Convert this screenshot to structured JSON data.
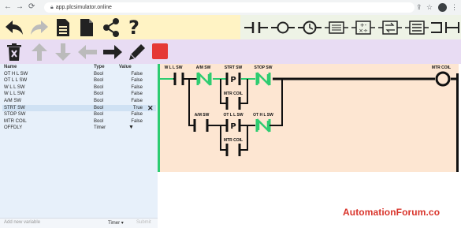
{
  "browser": {
    "url": "app.plcsimulator.online"
  },
  "toolbar_top": {
    "left_buttons": [
      "undo-icon",
      "redo-icon",
      "document-icon",
      "new-file-icon",
      "share-icon",
      "help-icon"
    ],
    "right_buttons": [
      "contact-no-icon",
      "coil-icon",
      "timer-icon",
      "compare-icon",
      "math-icon",
      "move-icon",
      "counter-icon",
      "branch-icon",
      "wire-icon"
    ]
  },
  "toolbar_second": {
    "buttons": [
      "delete-icon",
      "arrow-up-icon",
      "arrow-down-icon",
      "arrow-left-icon",
      "arrow-right-icon",
      "pencil-icon",
      "stop-icon"
    ],
    "accent_stop": "#e53935"
  },
  "variables": {
    "headers": {
      "name": "Name",
      "type": "Type",
      "value": "Value"
    },
    "rows": [
      {
        "name": "OT H L SW",
        "type": "Bool",
        "value": "False"
      },
      {
        "name": "OT L L SW",
        "type": "Bool",
        "value": "False"
      },
      {
        "name": "W L L SW",
        "type": "Bool",
        "value": "False"
      },
      {
        "name": "W L L SW",
        "type": "Bool",
        "value": "False"
      },
      {
        "name": "A/M SW",
        "type": "Bool",
        "value": "False"
      },
      {
        "name": "STRT SW",
        "type": "Bool",
        "value": "True"
      },
      {
        "name": "STOP SW",
        "type": "Bool",
        "value": "False"
      },
      {
        "name": "MTR COIL",
        "type": "Bool",
        "value": "False"
      },
      {
        "name": "OFFDLY",
        "type": "Timer",
        "value": ""
      }
    ],
    "add_placeholder": "Add new variable",
    "add_type": "Timer",
    "submit_label": "Submit"
  },
  "ladder": {
    "labels": {
      "wll": "W L L SW",
      "am_top": "A/M SW",
      "strt": "STRT SW",
      "stop": "STOP SW",
      "mtr_coil_out": "MTR COIL",
      "mtr_coil_1": "MTR COIL",
      "am_bot": "A/M SW",
      "otll": "OT L L SW",
      "othl": "OT H L SW",
      "mtr_coil_2": "MTR COIL"
    },
    "powered_color": "#2ecc71"
  },
  "watermark": "AutomationForum.co"
}
